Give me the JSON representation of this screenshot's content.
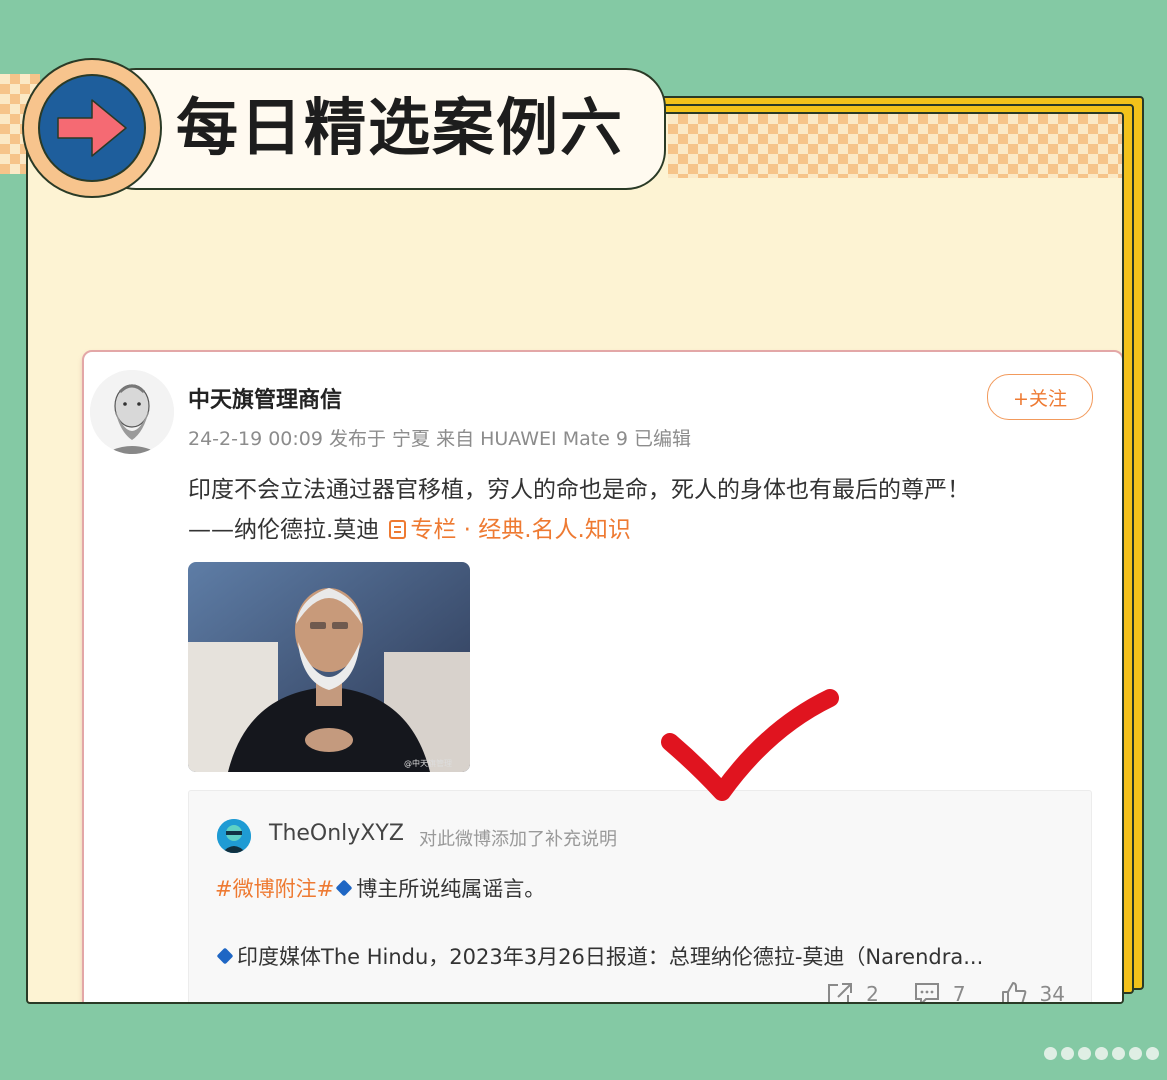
{
  "page_title": "每日精选案例六",
  "post": {
    "author": "中天旗管理商信",
    "meta": "24-2-19 00:09 发布于 宁夏 来自 HUAWEI Mate 9 已编辑",
    "follow_label": "+关注",
    "text_line1": "印度不会立法通过器官移植，穷人的命也是命，死人的身体也有最后的尊严！",
    "text_line2": "——纳伦德拉.莫迪",
    "column_link": "专栏 · 经典.名人.知识",
    "image_watermark": "@中天旗管理"
  },
  "note": {
    "username": "TheOnlyXYZ",
    "description": "对此微博添加了补充说明",
    "hashtag": "#微博附注#",
    "line1_text": "博主所说纯属谣言。",
    "line2_text": "印度媒体The Hindu，2023年3月26日报道：总理纳伦德拉-莫迪（Narendra..."
  },
  "actions": {
    "share_count": "2",
    "comment_count": "7",
    "like_count": "34"
  },
  "colors": {
    "background": "#84c9a4",
    "accent_orange": "#ee7a32",
    "check_red": "#e0141f",
    "frame_yellow": "#f3c21a"
  }
}
